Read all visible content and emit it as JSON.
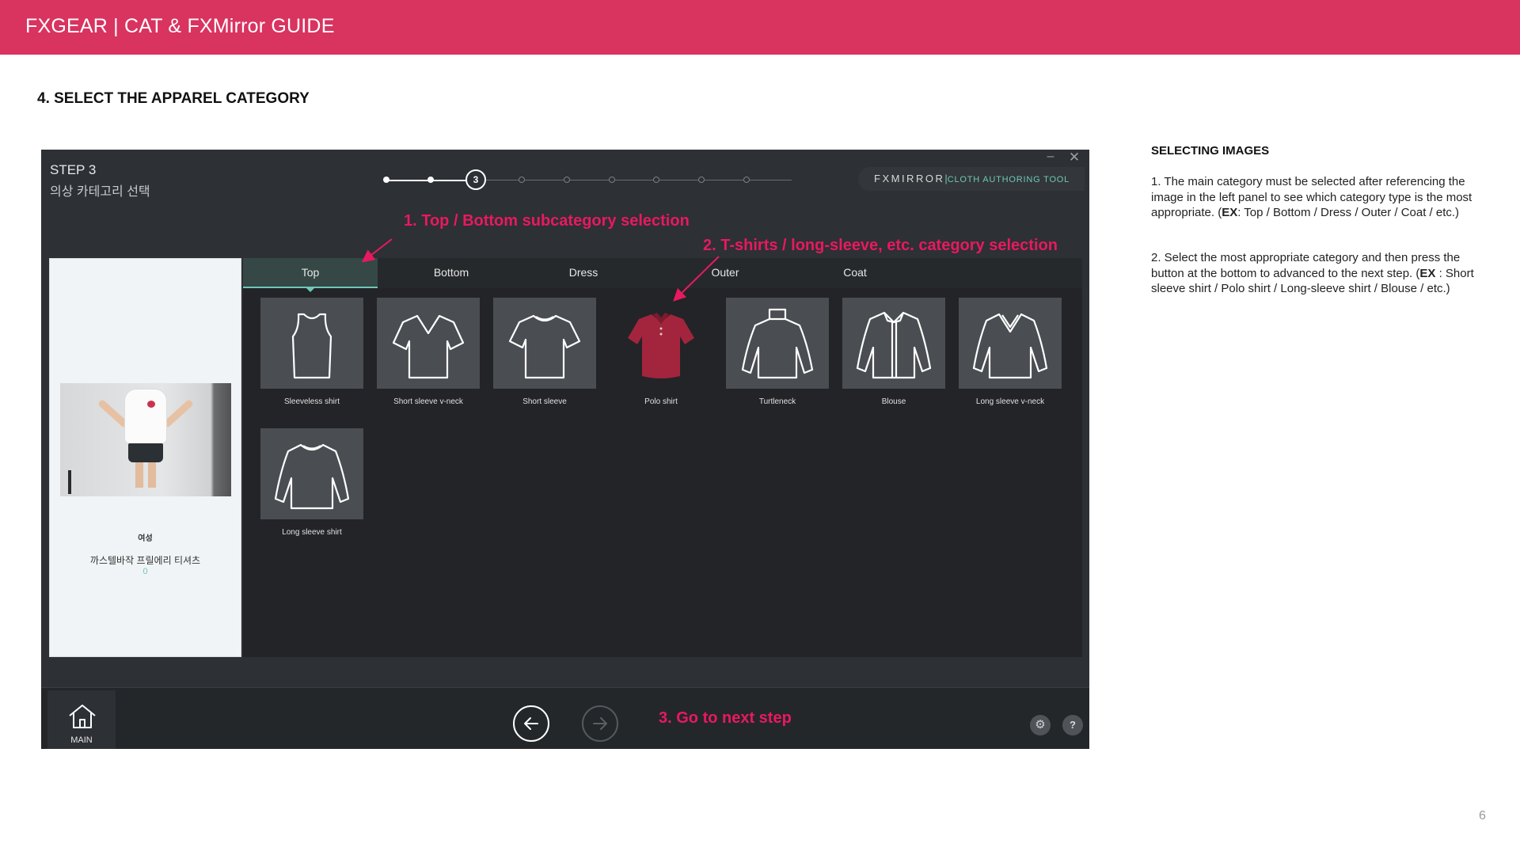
{
  "banner": {
    "title": "FXGEAR | CAT & FXMirror GUIDE",
    "color": "#d93360"
  },
  "section_heading": "4. SELECT THE APPAREL CATEGORY",
  "app": {
    "step_title": "STEP 3",
    "step_subtitle": "의상 카테고리 선택",
    "stepper": {
      "current": "3",
      "total_steps": 9,
      "current_step": 3
    },
    "window_controls": {
      "minimize": "–",
      "close": "✕"
    },
    "brand": {
      "name": "FXMIRROR",
      "separator": "|",
      "tool": "CLOTH AUTHORING TOOL"
    },
    "preview": {
      "gender": "여성",
      "product": "까스텔바작 프릴에리 티셔츠",
      "count": "0"
    },
    "tabs": [
      {
        "label": "Top",
        "active": true
      },
      {
        "label": "Bottom",
        "active": false
      },
      {
        "label": "Dress",
        "active": false
      },
      {
        "label": "Outer",
        "active": false
      },
      {
        "label": "Coat",
        "active": false
      }
    ],
    "items": [
      {
        "label": "Sleeveless shirt",
        "icon": "sleeveless-shirt-icon"
      },
      {
        "label": "Short sleeve v-neck",
        "icon": "short-sleeve-vneck-icon"
      },
      {
        "label": "Short sleeve",
        "icon": "short-sleeve-icon"
      },
      {
        "label": "Polo shirt",
        "icon": "polo-shirt-photo"
      },
      {
        "label": "Turtleneck",
        "icon": "turtleneck-icon"
      },
      {
        "label": "Blouse",
        "icon": "blouse-icon"
      },
      {
        "label": "Long sleeve v-neck",
        "icon": "long-sleeve-vneck-icon"
      },
      {
        "label": "Long sleeve shirt",
        "icon": "long-sleeve-shirt-icon"
      }
    ],
    "bottom": {
      "home_label": "MAIN",
      "settings_icon": "gear-icon",
      "help_label": "?"
    }
  },
  "annotations": {
    "a1": "1. Top / Bottom subcategory selection",
    "a2": "2. T-shirts / long-sleeve, etc. category selection",
    "a3": "3. Go to next step",
    "color": "#e8195f"
  },
  "side": {
    "heading": "SELECTING IMAGES",
    "p1_text": "1. The main category must be selected after referencing the image in the left panel to see which category type is the most appropriate. (",
    "p1_ex": "EX",
    "p1_rest": ": Top / Bottom / Dress / Outer / Coat / etc.)",
    "p2_text": "2. Select the most appropriate category and then press the button at the bottom to advanced to the next step. (",
    "p2_ex": "EX",
    "p2_rest": " : Short sleeve shirt / Polo shirt / Long-sleeve shirt / Blouse / etc.)"
  },
  "page_number": "6"
}
